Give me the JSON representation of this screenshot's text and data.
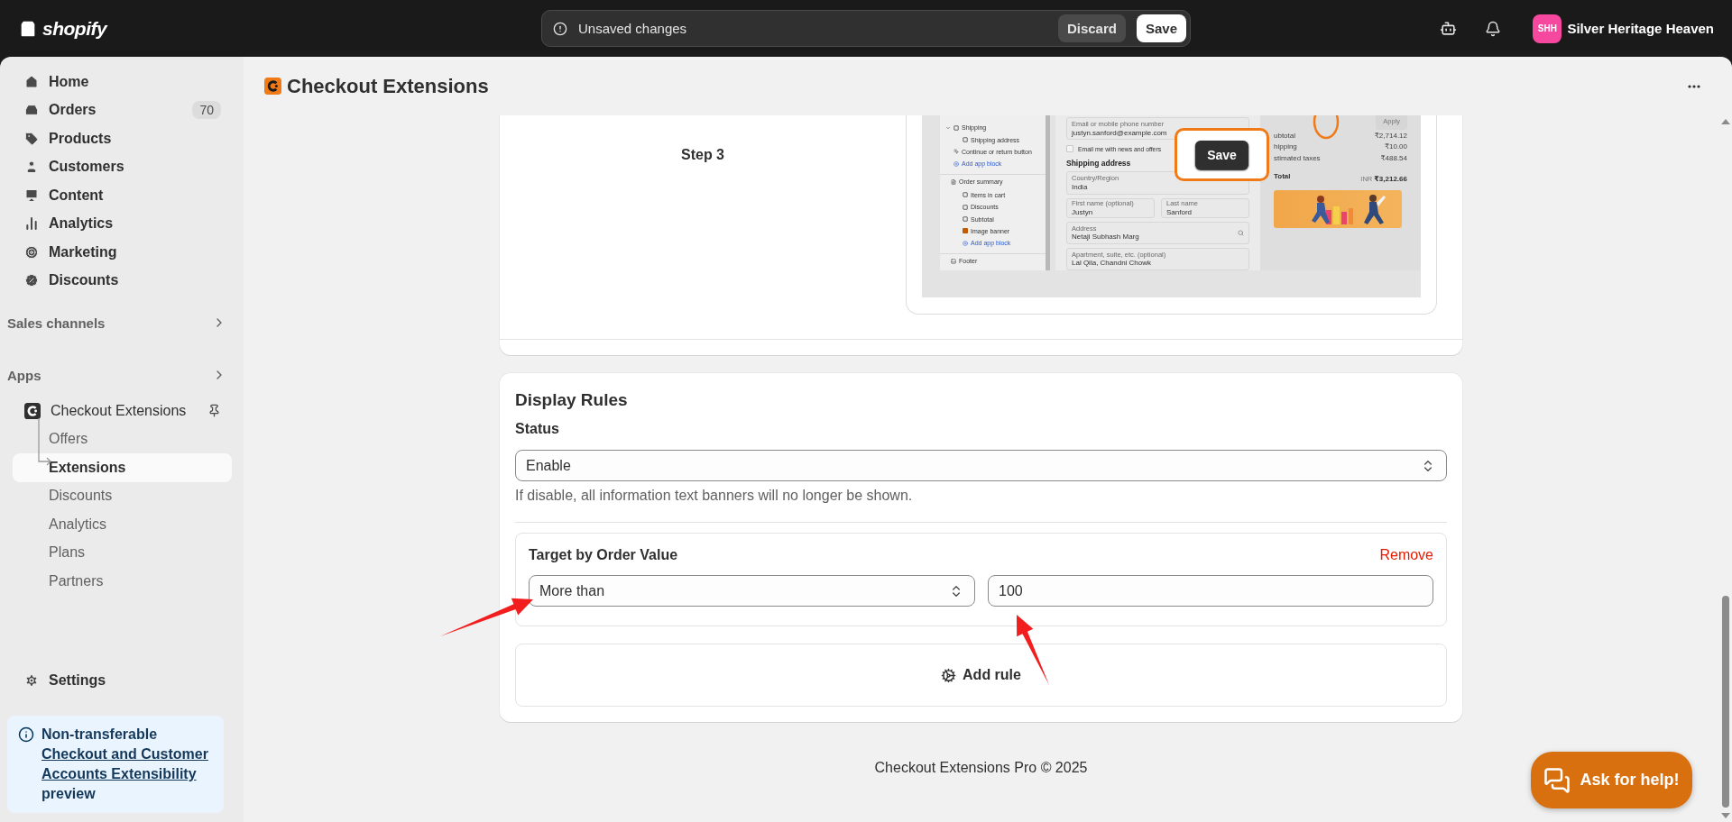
{
  "topbar": {
    "logo": "shopify",
    "notice": "Unsaved changes",
    "buttons": [
      {
        "label": "Discard",
        "kind": "secondary"
      },
      {
        "label": "Save",
        "kind": "primary"
      }
    ],
    "store": {
      "initials": "SHH",
      "name": "Silver Heritage Heaven"
    }
  },
  "sidebar": {
    "nav": [
      {
        "label": "Home"
      },
      {
        "label": "Orders",
        "badge": "70"
      },
      {
        "label": "Products"
      },
      {
        "label": "Customers"
      },
      {
        "label": "Content"
      },
      {
        "label": "Analytics"
      },
      {
        "label": "Marketing"
      },
      {
        "label": "Discounts"
      }
    ],
    "sections": [
      "Sales channels",
      "Apps"
    ],
    "app": {
      "name": "Checkout Extensions",
      "items": [
        {
          "label": "Offers",
          "selected": false
        },
        {
          "label": "Extensions",
          "selected": true
        },
        {
          "label": "Discounts",
          "selected": false
        },
        {
          "label": "Analytics",
          "selected": false
        },
        {
          "label": "Plans",
          "selected": false
        },
        {
          "label": "Partners",
          "selected": false
        }
      ]
    },
    "settings": "Settings",
    "notice": {
      "title": "Non-transferable",
      "link": "Checkout and Customer Accounts Extensibility",
      "suffix": "preview"
    }
  },
  "page": {
    "title": "Checkout Extensions"
  },
  "step": {
    "label": "Step 3",
    "screenshot": {
      "outline": [
        {
          "kind": "group",
          "label": "Shipping",
          "expanded": true,
          "children": [
            {
              "kind": "block",
              "label": "Shipping address"
            }
          ]
        },
        {
          "kind": "button",
          "label": "Continue or return button"
        },
        {
          "kind": "link",
          "label": "Add app block"
        },
        {
          "kind": "section",
          "label": "Order summary",
          "children": [
            {
              "kind": "block",
              "label": "Items in cart"
            },
            {
              "kind": "block",
              "label": "Discounts"
            },
            {
              "kind": "block",
              "label": "Subtotal"
            },
            {
              "kind": "app",
              "label": "Image banner"
            },
            {
              "kind": "link",
              "label": "Add app block"
            }
          ]
        },
        {
          "kind": "section",
          "label": "Footer"
        }
      ],
      "form": [
        {
          "kind": "field",
          "label": "Email or mobile phone number",
          "value": "justyn.sanford@example.com"
        },
        {
          "kind": "checkbox",
          "label": "Email me with news and offers",
          "checked": false
        },
        {
          "kind": "heading",
          "label": "Shipping address"
        },
        {
          "kind": "field",
          "label": "Country/Region",
          "value": "India"
        },
        {
          "kind": "pair",
          "fields": [
            {
              "label": "First name (optional)",
              "value": "Justyn"
            },
            {
              "label": "Last name",
              "value": "Sanford"
            }
          ]
        },
        {
          "kind": "search",
          "label": "Address",
          "value": "Netaji Subhash Marg"
        },
        {
          "kind": "field",
          "label": "Apartment, suite, etc. (optional)",
          "value": "Lal Qila, Chandni Chowk"
        }
      ],
      "summary": {
        "apply": "Apply",
        "lines": [
          {
            "label": "ubtotal",
            "amount": "₹2,714.12"
          },
          {
            "label": "hipping",
            "amount": "₹10.00"
          },
          {
            "label": "stimated taxes",
            "amount": "₹488.54"
          }
        ],
        "total": {
          "label": "Total",
          "currency": "INR",
          "amount": "₹3,212.66"
        }
      },
      "callout": "Save"
    }
  },
  "display_rules": {
    "title": "Display Rules",
    "status_label": "Status",
    "status_value": "Enable",
    "help": "If disable, all information text banners will no longer be shown.",
    "rule": {
      "title": "Target by Order Value",
      "remove": "Remove",
      "operator": "More than",
      "value": "100"
    },
    "add_rule": "Add rule"
  },
  "footer": "Checkout Extensions Pro © 2025",
  "help_button": "Ask for help!"
}
